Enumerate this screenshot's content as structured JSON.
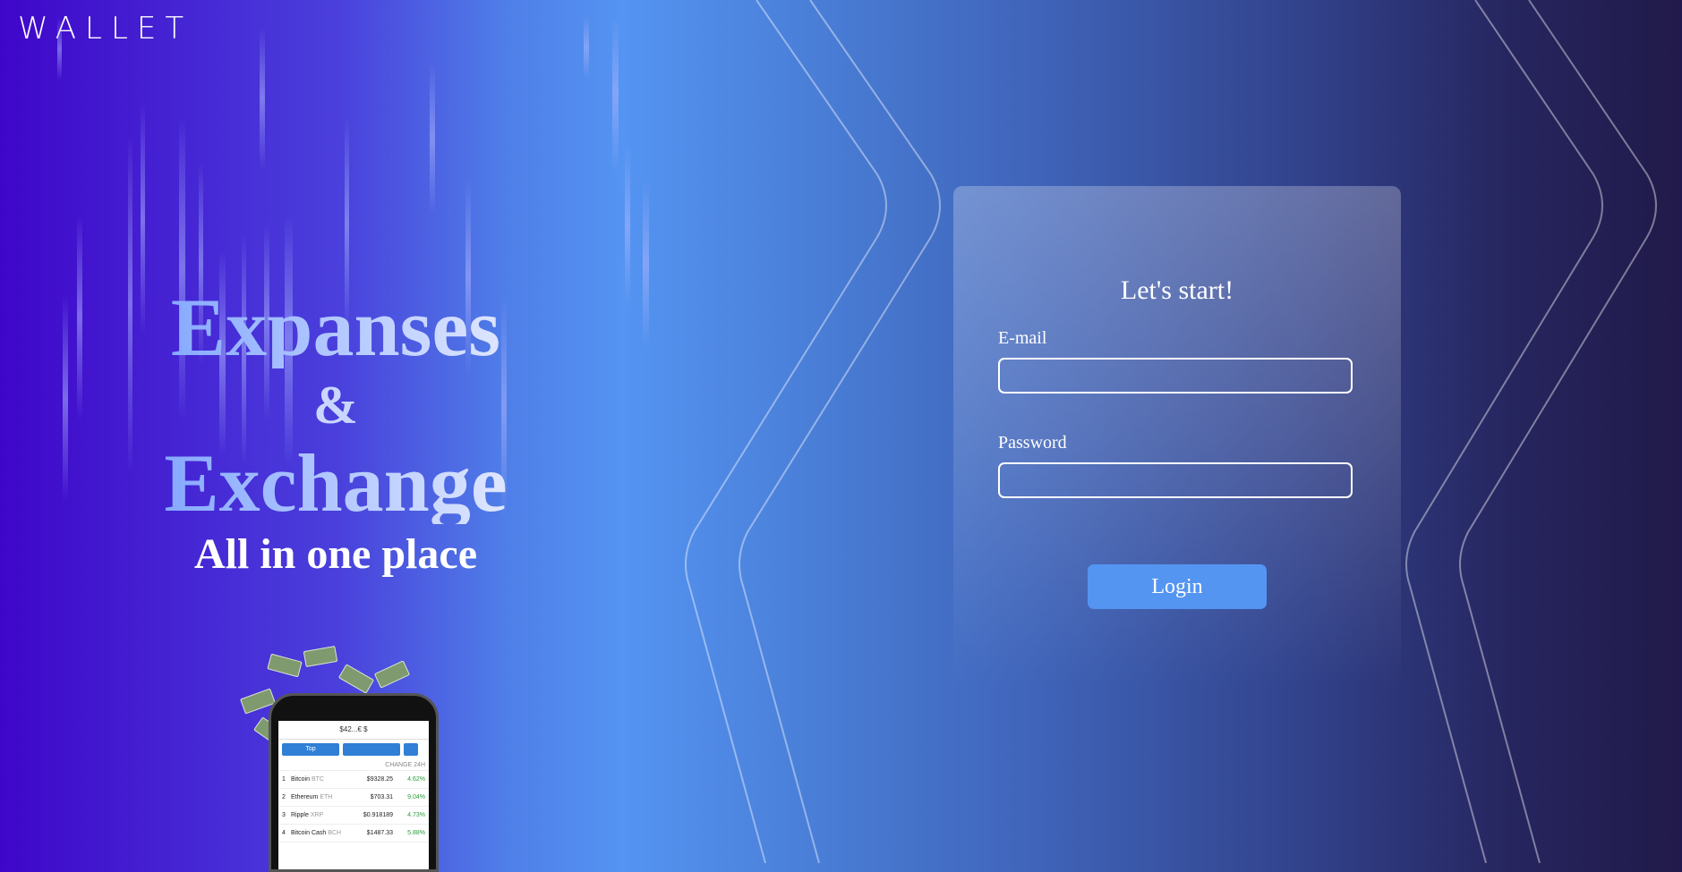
{
  "app": {
    "logo": "WALLET"
  },
  "hero": {
    "line1": "Expanses",
    "amp": "&",
    "line2": "Exchange",
    "tagline": "All in one place"
  },
  "login": {
    "title": "Let's start!",
    "email_label": "E-mail",
    "email_value": "",
    "password_label": "Password",
    "password_value": "",
    "button_label": "Login"
  },
  "phone": {
    "header": "$42...€ $",
    "buttons": [
      "Top",
      "",
      ""
    ],
    "column_header": "CHANGE 24H",
    "rows": [
      {
        "rank": "1",
        "name": "Bitcoin",
        "symbol": "BTC",
        "price": "$9328.25",
        "change": "4.62%"
      },
      {
        "rank": "2",
        "name": "Ethereum",
        "symbol": "ETH",
        "price": "$703.31",
        "change": "9.04%"
      },
      {
        "rank": "3",
        "name": "Ripple",
        "symbol": "XRP",
        "price": "$0.918189",
        "change": "4.73%"
      },
      {
        "rank": "4",
        "name": "Bitcoin Cash",
        "symbol": "BCH",
        "price": "$1487.33",
        "change": "5.88%"
      }
    ]
  },
  "colors": {
    "accent": "#5495f2",
    "bg_left": "#3f06c9",
    "bg_mid": "#5494f2",
    "bg_right": "#211a4a"
  }
}
